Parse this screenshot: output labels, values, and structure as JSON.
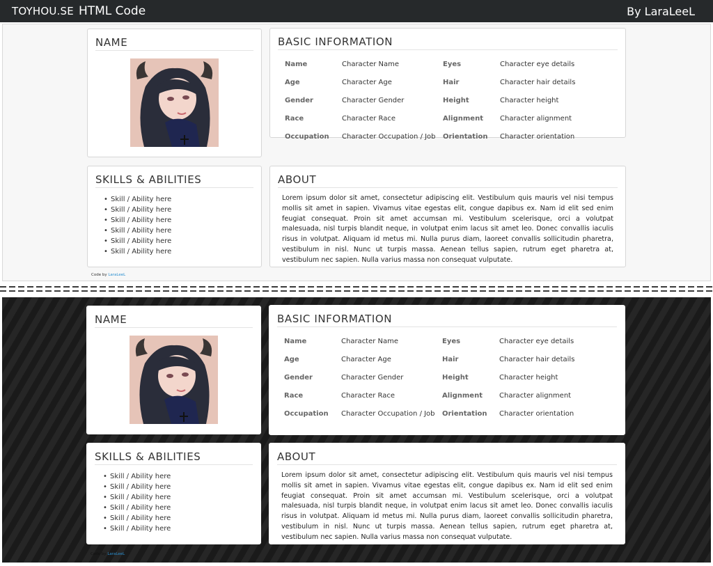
{
  "header": {
    "site": "TOYHOU.SE",
    "subtitle": "HTML Code",
    "author": "By LaraLeeL"
  },
  "name_card": {
    "title": "NAME",
    "portrait_icon": "character-portrait"
  },
  "basic_info": {
    "title": "BASIC INFORMATION",
    "rows": [
      {
        "label1": "Name",
        "value1": "Character Name",
        "label2": "Eyes",
        "value2": "Character eye details"
      },
      {
        "label1": "Age",
        "value1": "Character Age",
        "label2": "Hair",
        "value2": "Character hair details"
      },
      {
        "label1": "Gender",
        "value1": "Character Gender",
        "label2": "Height",
        "value2": "Character height"
      },
      {
        "label1": "Race",
        "value1": "Character Race",
        "label2": "Alignment",
        "value2": "Character alignment"
      },
      {
        "label1": "Occupation",
        "value1": "Character Occupation / Job",
        "label2": "Orientation",
        "value2": "Character orientation"
      }
    ]
  },
  "skills": {
    "title": "SKILLS & ABILITIES",
    "items": [
      "Skill / Ability here",
      "Skill / Ability here",
      "Skill / Ability here",
      "Skill / Ability here",
      "Skill / Ability here",
      "Skill / Ability here"
    ]
  },
  "about": {
    "title": "ABOUT",
    "text": "Lorem ipsum dolor sit amet, consectetur adipiscing elit. Vestibulum quis mauris vel nisi tempus mollis sit amet in sapien. Vivamus vitae egestas elit, congue dapibus ex. Nam id elit sed enim feugiat consequat. Proin sit amet accumsan mi. Vestibulum scelerisque, orci a volutpat malesuada, nisl turpis blandit neque, in volutpat enim lacus sit amet leo. Donec convallis iaculis risus in volutpat. Aliquam id metus mi. Nulla purus diam, laoreet convallis sollicitudin pharetra, vestibulum in nisl. Nunc ut turpis massa. Aenean tellus sapien, rutrum eget pharetra at, vestibulum nec sapien. Nulla varius massa non consequat vulputate."
  },
  "credit": {
    "prefix": "Code by",
    "link": "LaraLeeL"
  },
  "colors": {
    "topbar": "#26292b",
    "dark_bg": "#1f1f1f",
    "link": "#2a8fd0"
  }
}
